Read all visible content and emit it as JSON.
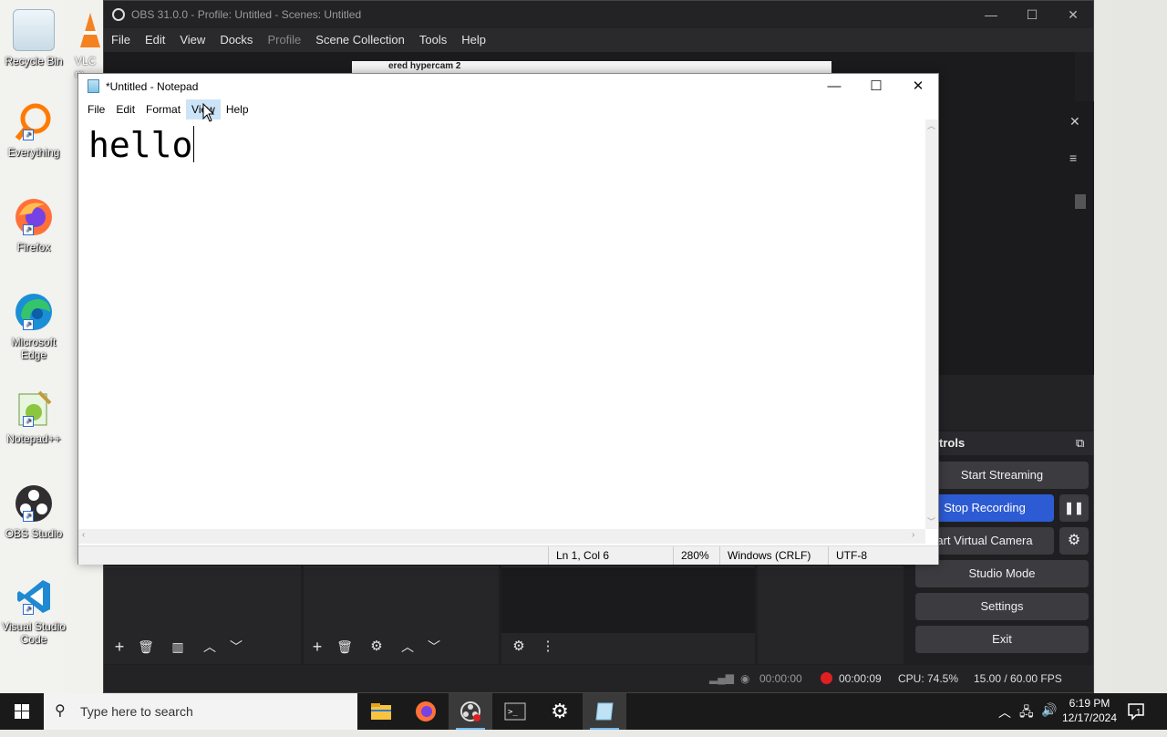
{
  "desktop": {
    "icons": [
      {
        "label": "Recycle Bin",
        "icon": "recycle-bin-icon"
      },
      {
        "label": "Everything",
        "icon": "everything-search-icon"
      },
      {
        "label": "Firefox",
        "icon": "firefox-icon"
      },
      {
        "label": "Microsoft Edge",
        "icon": "edge-icon"
      },
      {
        "label": "Notepad++",
        "icon": "notepadpp-icon"
      },
      {
        "label": "OBS Studio",
        "icon": "obs-icon"
      },
      {
        "label": "Visual Studio Code",
        "icon": "vscode-icon"
      }
    ],
    "partial_icon_label": "VLC m"
  },
  "obs": {
    "title": "OBS 31.0.0 - Profile: Untitled - Scenes: Untitled",
    "menu": [
      "File",
      "Edit",
      "View",
      "Docks",
      "Profile",
      "Scene Collection",
      "Tools",
      "Help"
    ],
    "preview_window_title": "ered hypercam 2",
    "controls_header": "trols",
    "buttons": {
      "start_streaming": "Start Streaming",
      "stop_recording": "Stop Recording",
      "start_virtual_camera": "art Virtual Camera",
      "studio_mode": "Studio Mode",
      "settings": "Settings",
      "exit": "Exit"
    },
    "status": {
      "stream_time": "00:00:00",
      "record_time": "00:00:09",
      "cpu": "CPU: 74.5%",
      "fps": "15.00 / 60.00 FPS"
    },
    "colors": {
      "accent_blue": "#2d5bd3",
      "record_red": "#e02020"
    }
  },
  "notepad": {
    "title": "*Untitled - Notepad",
    "menu": [
      "File",
      "Edit",
      "Format",
      "View",
      "Help"
    ],
    "content": "hello",
    "status": {
      "position": "Ln 1, Col 6",
      "zoom": "280%",
      "line_ending": "Windows (CRLF)",
      "encoding": "UTF-8"
    }
  },
  "taskbar": {
    "search_placeholder": "Type here to search",
    "apps": [
      "file-explorer-icon",
      "firefox-icon",
      "obs-icon",
      "terminal-icon",
      "settings-gear-icon",
      "notepad-icon"
    ],
    "time": "6:19 PM",
    "date": "12/17/2024",
    "notification_count": "1"
  }
}
